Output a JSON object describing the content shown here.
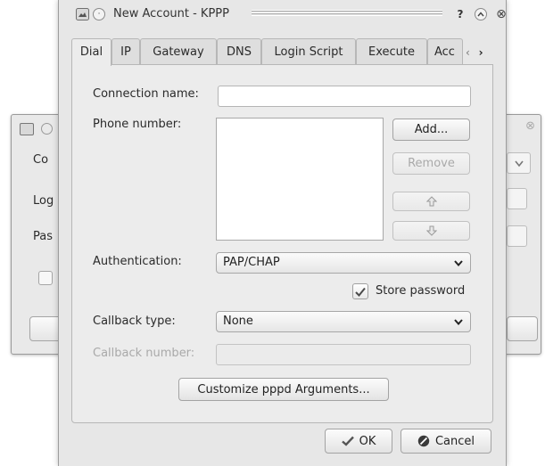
{
  "background_window": {
    "labels": [
      "Co",
      "Log",
      "Pas"
    ]
  },
  "window": {
    "title": "New Account - KPPP",
    "title_buttons": [
      "help-icon",
      "minimize-icon",
      "close-icon"
    ]
  },
  "tabs": [
    {
      "label": "Dial",
      "active": true
    },
    {
      "label": "IP"
    },
    {
      "label": "Gateway"
    },
    {
      "label": "DNS"
    },
    {
      "label": "Login Script"
    },
    {
      "label": "Execute"
    },
    {
      "label": "Acc"
    }
  ],
  "tab_scroll": {
    "left": "‹",
    "right": "›"
  },
  "form": {
    "connection_name_label": "Connection name:",
    "connection_name_value": "",
    "phone_number_label": "Phone number:",
    "phone_numbers": [],
    "add_button": "Add...",
    "remove_button": "Remove",
    "authentication_label": "Authentication:",
    "authentication_value": "PAP/CHAP",
    "store_password_label": "Store password",
    "store_password_checked": true,
    "callback_type_label": "Callback type:",
    "callback_type_value": "None",
    "callback_number_label": "Callback number:",
    "callback_number_value": "",
    "customize_button": "Customize pppd Arguments..."
  },
  "footer": {
    "ok_label": "OK",
    "cancel_label": "Cancel"
  },
  "colors": {
    "window_bg": "#e7e7e7",
    "panel_bg": "#ececec",
    "ok_check": "#555555",
    "cancel_icon": "#333333"
  }
}
